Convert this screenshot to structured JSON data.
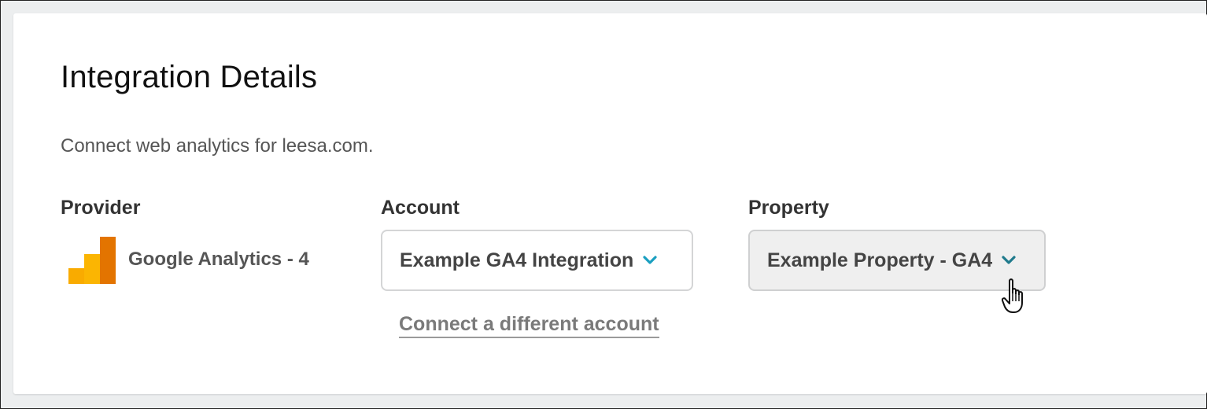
{
  "header": {
    "title": "Integration Details",
    "subtitle": "Connect web analytics for leesa.com."
  },
  "provider": {
    "label": "Provider",
    "name": "Google Analytics - 4",
    "icon": "google-analytics-icon",
    "icon_colors": [
      "#F9AB00",
      "#E37400"
    ]
  },
  "account": {
    "label": "Account",
    "selected": "Example GA4 Integration",
    "chevron_color": "#1a9fc0"
  },
  "property": {
    "label": "Property",
    "selected": "Example Property - GA4",
    "chevron_color": "#1f7a8c"
  },
  "connect_link": {
    "label": "Connect a different account"
  }
}
